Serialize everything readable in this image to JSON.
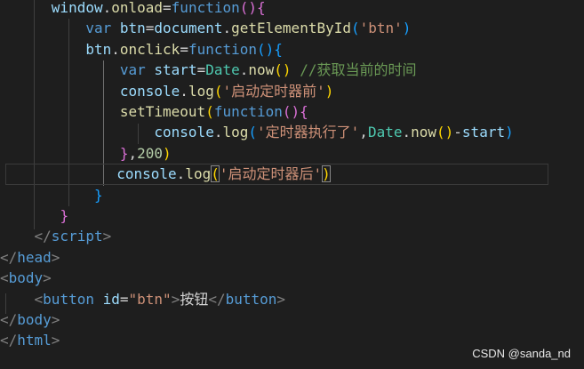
{
  "code": {
    "l1": {
      "obj": "window",
      "dot": ".",
      "prop": "onload",
      "eq": "=",
      "kw": "function",
      "open": "()",
      "brace": "{"
    },
    "l2": {
      "kw": "var",
      "name": "btn",
      "eq": "=",
      "obj": "document",
      "dot": ".",
      "method": "getElementById",
      "open": "(",
      "str": "'btn'",
      "close": ")"
    },
    "l3": {
      "obj": "btn",
      "dot": ".",
      "prop": "onclick",
      "eq": "=",
      "kw": "function",
      "open": "()",
      "brace": "{"
    },
    "l4": {
      "kw": "var",
      "name": "start",
      "eq": "=",
      "cls": "Date",
      "dot": ".",
      "method": "now",
      "call": "()",
      "comment": "//获取当前的时间"
    },
    "l5": {
      "obj": "console",
      "dot": ".",
      "method": "log",
      "open": "(",
      "str": "'启动定时器前'",
      "close": ")"
    },
    "l6": {
      "method": "setTimeout",
      "open": "(",
      "kw": "function",
      "call": "()",
      "brace": "{"
    },
    "l7": {
      "obj": "console",
      "dot": ".",
      "method": "log",
      "open": "(",
      "str": "'定时器执行了'",
      "comma": ",",
      "cls": "Date",
      "dot2": ".",
      "method2": "now",
      "call": "()",
      "minus": "-",
      "name": "start",
      "close": ")"
    },
    "l8": {
      "brace": "}",
      "comma": ",",
      "num": "200",
      "close": ")"
    },
    "l9": {
      "obj": "console",
      "dot": ".",
      "method": "log",
      "open": "(",
      "str": "'启动定时器后'",
      "close": ")"
    },
    "l10": {
      "brace": "}"
    },
    "l11": {
      "brace": "}"
    },
    "l12": {
      "lt": "</",
      "tag": "script",
      "gt": ">"
    },
    "l13": {
      "lt": "</",
      "tag": "head",
      "gt": ">"
    },
    "l14": {
      "lt": "<",
      "tag": "body",
      "gt": ">"
    },
    "l15": {
      "lt": "<",
      "tag": "button",
      "attr": "id",
      "eq": "=",
      "val": "\"btn\"",
      "gt": ">",
      "text": "按钮",
      "lt2": "</",
      "tag2": "button",
      "gt2": ">"
    },
    "l16": {
      "lt": "</",
      "tag": "body",
      "gt": ">"
    },
    "l17": {
      "lt": "</",
      "tag": "html",
      "gt": ">"
    }
  },
  "watermark": "CSDN @sanda_nd",
  "colors": {
    "background": "#1e1e1e",
    "keyword": "#569cd6",
    "function": "#dcdcaa",
    "variable": "#9cdcfe",
    "string": "#ce9178",
    "number": "#b5cea8",
    "comment": "#6a9955",
    "class": "#4ec9b0",
    "bracket_level1": "#ffd700",
    "bracket_level2": "#da70d6",
    "bracket_level3": "#179fff"
  }
}
